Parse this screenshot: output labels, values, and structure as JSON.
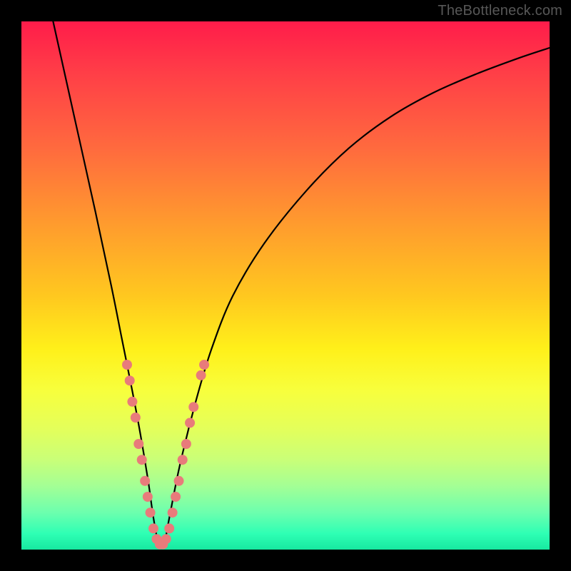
{
  "watermark": "TheBottleneck.com",
  "chart_data": {
    "type": "line",
    "title": "",
    "xlabel": "",
    "ylabel": "",
    "xlim": [
      0,
      100
    ],
    "ylim": [
      0,
      100
    ],
    "grid": false,
    "legend": false,
    "series": [
      {
        "name": "bottleneck-curve",
        "color": "#000000",
        "x": [
          6,
          10,
          14,
          17,
          19,
          21,
          22.5,
          24,
          25,
          26,
          27,
          28,
          30,
          33,
          36,
          40,
          46,
          54,
          62,
          70,
          78,
          86,
          94,
          100
        ],
        "y": [
          100,
          82,
          64,
          50,
          40,
          30,
          22,
          13,
          6,
          1,
          1,
          6,
          16,
          28,
          38,
          48,
          58,
          68,
          76,
          82,
          86.5,
          90,
          93,
          95
        ]
      }
    ],
    "points": [
      {
        "name": "cluster-dots",
        "color": "#e87b7b",
        "r": 7,
        "data": [
          {
            "x": 20.0,
            "y": 35
          },
          {
            "x": 20.5,
            "y": 32
          },
          {
            "x": 21.0,
            "y": 28
          },
          {
            "x": 21.6,
            "y": 25
          },
          {
            "x": 22.2,
            "y": 20
          },
          {
            "x": 22.8,
            "y": 17
          },
          {
            "x": 23.4,
            "y": 13
          },
          {
            "x": 23.9,
            "y": 10
          },
          {
            "x": 24.4,
            "y": 7
          },
          {
            "x": 25.0,
            "y": 4
          },
          {
            "x": 25.6,
            "y": 2
          },
          {
            "x": 26.2,
            "y": 1
          },
          {
            "x": 26.8,
            "y": 1
          },
          {
            "x": 27.4,
            "y": 2
          },
          {
            "x": 28.0,
            "y": 4
          },
          {
            "x": 28.6,
            "y": 7
          },
          {
            "x": 29.2,
            "y": 10
          },
          {
            "x": 29.8,
            "y": 13
          },
          {
            "x": 30.5,
            "y": 17
          },
          {
            "x": 31.2,
            "y": 20
          },
          {
            "x": 31.9,
            "y": 24
          },
          {
            "x": 32.6,
            "y": 27
          },
          {
            "x": 34.0,
            "y": 33
          },
          {
            "x": 34.6,
            "y": 35
          }
        ]
      }
    ],
    "background_gradient": {
      "direction": "vertical",
      "stops": [
        {
          "pos": 0.0,
          "color": "#ff1c4a"
        },
        {
          "pos": 0.38,
          "color": "#ff9a2e"
        },
        {
          "pos": 0.62,
          "color": "#fff01a"
        },
        {
          "pos": 0.88,
          "color": "#a3ff95"
        },
        {
          "pos": 1.0,
          "color": "#17e9a0"
        }
      ]
    }
  }
}
